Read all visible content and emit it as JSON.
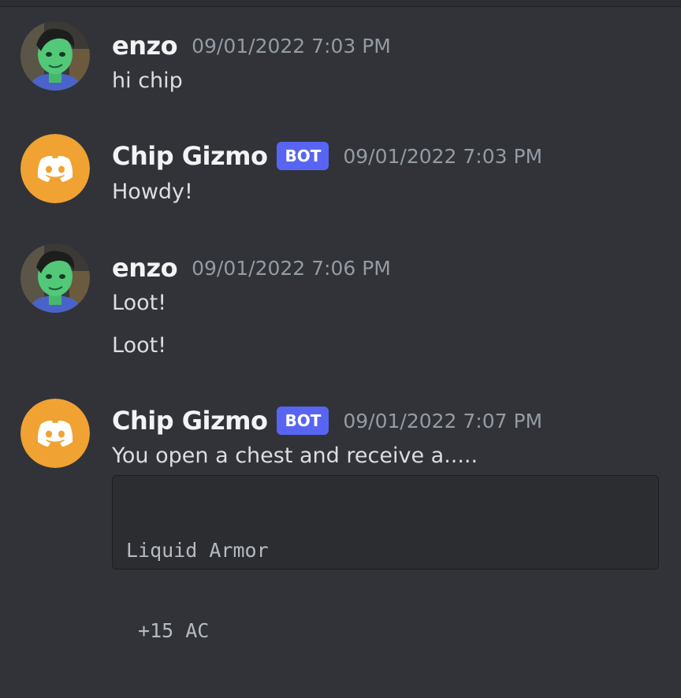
{
  "messages": [
    {
      "author": "enzo",
      "timestamp": "09/01/2022 7:03 PM",
      "avatar_icon": "user-avatar-green-character",
      "lines": [
        "hi chip"
      ]
    },
    {
      "author": "Chip Gizmo",
      "bot_tag": "BOT",
      "timestamp": "09/01/2022 7:03 PM",
      "avatar_icon": "discord-logo-icon",
      "lines": [
        "Howdy!"
      ]
    },
    {
      "author": "enzo",
      "timestamp": "09/01/2022 7:06 PM",
      "avatar_icon": "user-avatar-green-character",
      "lines": [
        "Loot!",
        "Loot!"
      ]
    },
    {
      "author": "Chip Gizmo",
      "bot_tag": "BOT",
      "timestamp": "09/01/2022 7:07 PM",
      "avatar_icon": "discord-logo-icon",
      "lines": [
        "You open a chest and receive a....."
      ],
      "code_block": [
        "Liquid Armor",
        " +15 AC"
      ]
    }
  ],
  "colors": {
    "background": "#313338",
    "bot_tag": "#5865f2",
    "bot_avatar": "#f0a232",
    "username": "#f2f3f5",
    "timestamp": "#949ba4",
    "message_text": "#dbdee1",
    "code_block_bg": "#2b2d31"
  }
}
